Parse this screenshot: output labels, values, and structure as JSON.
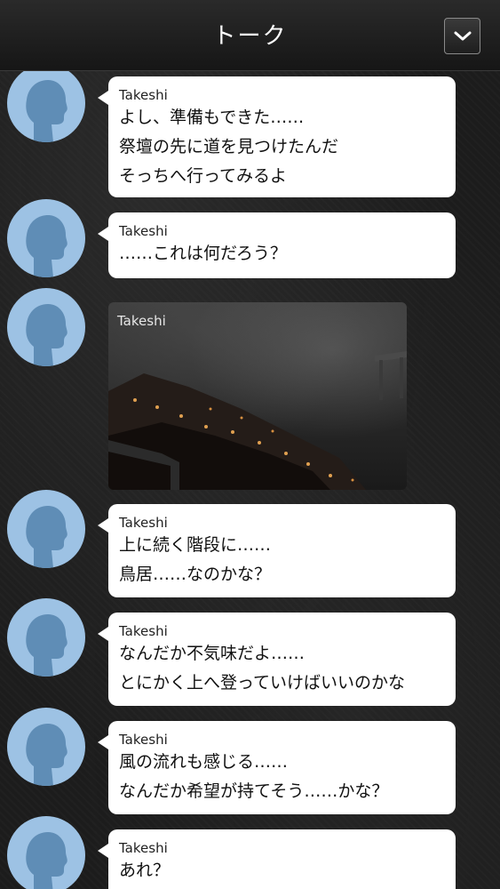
{
  "header": {
    "title": "トーク"
  },
  "messages": [
    {
      "sender": "Takeshi",
      "lines": [
        "よし、準備もできた……",
        "祭壇の先に道を見つけたんだ",
        "そっちへ行ってみるよ"
      ]
    },
    {
      "sender": "Takeshi",
      "lines": [
        "……これは何だろう？"
      ]
    },
    {
      "sender": "Takeshi",
      "type": "image"
    },
    {
      "sender": "Takeshi",
      "lines": [
        "上に続く階段に……",
        "鳥居……なのかな？"
      ]
    },
    {
      "sender": "Takeshi",
      "lines": [
        "なんだか不気味だよ……",
        "とにかく上へ登っていけばいいのかな"
      ]
    },
    {
      "sender": "Takeshi",
      "lines": [
        "風の流れも感じる……",
        "なんだか希望が持てそう……かな？"
      ]
    },
    {
      "sender": "Takeshi",
      "lines": [
        "あれ？"
      ]
    }
  ],
  "colors": {
    "bubble": "#ffffff",
    "avatar": "#9dc2e4",
    "avatar_silhouette": "#5f8db6",
    "header_text": "#ffffff"
  },
  "icons": {
    "collapse": "chevron-down-icon",
    "avatar": "person-silhouette-icon"
  }
}
